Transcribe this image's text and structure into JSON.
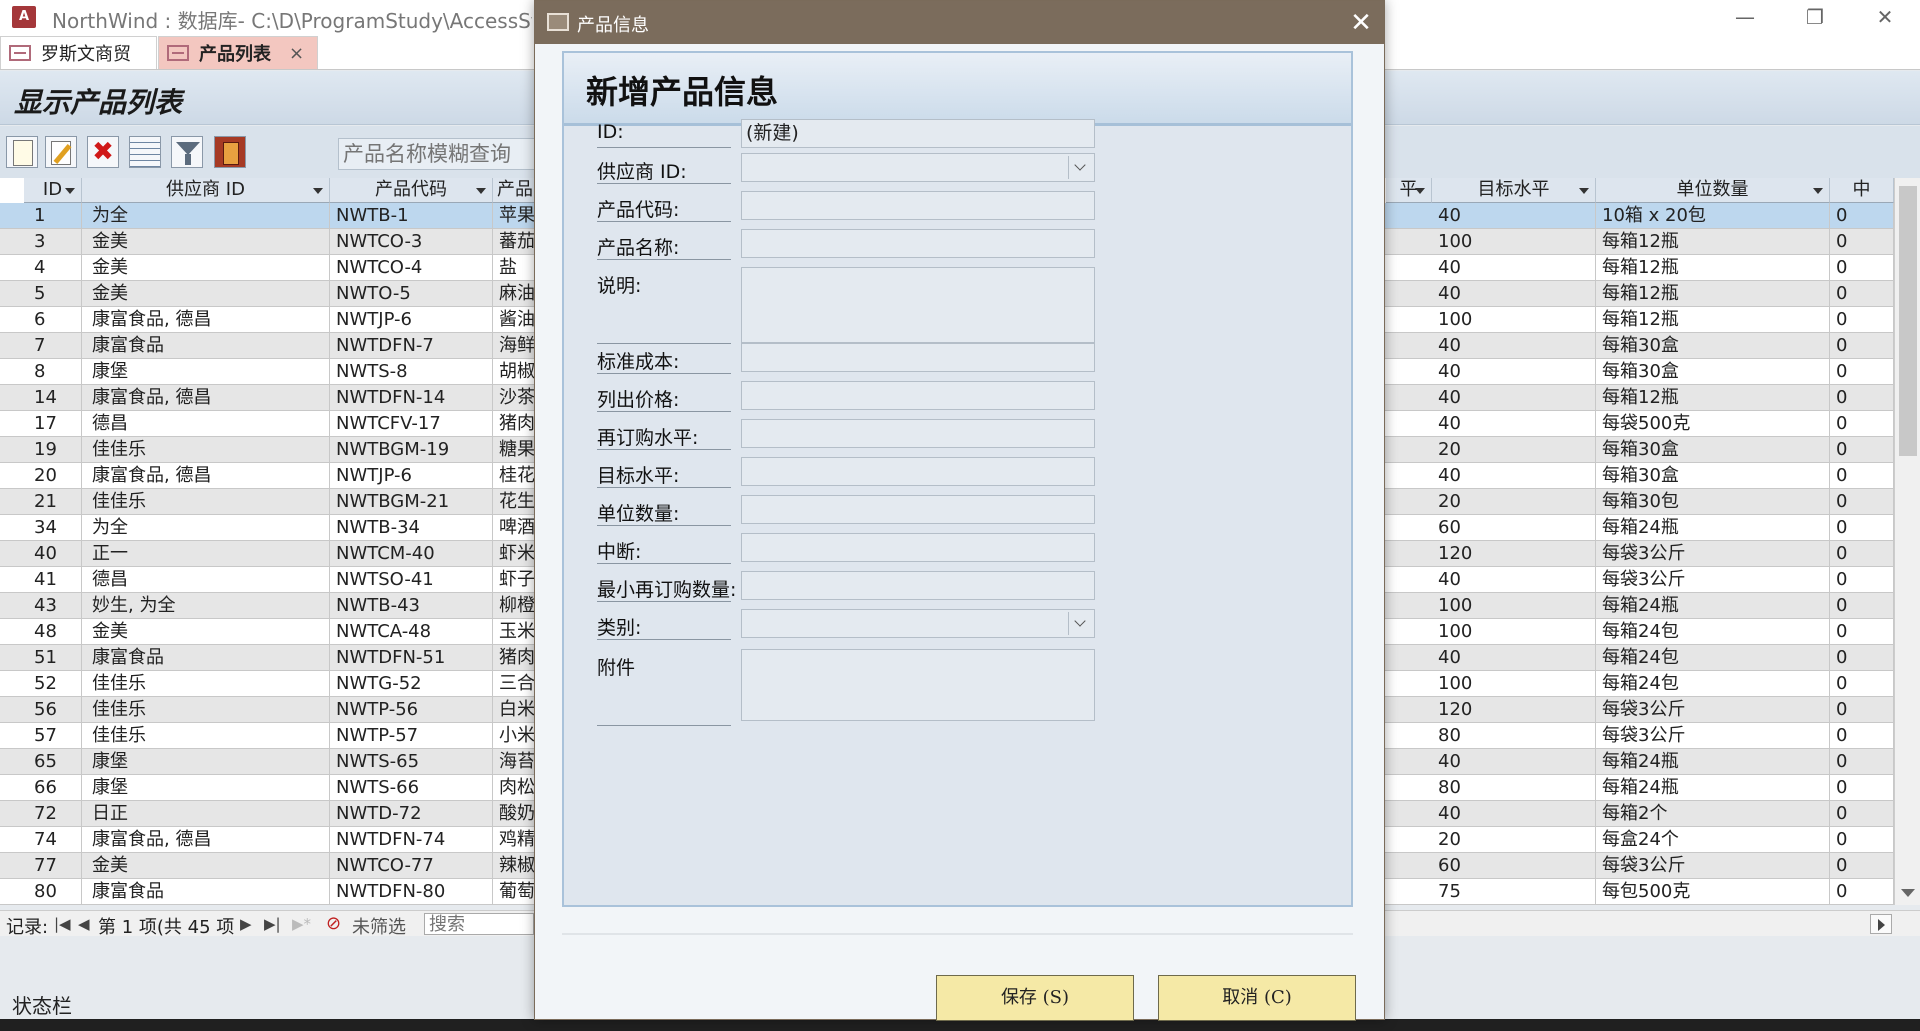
{
  "app": {
    "title": "NorthWind : 数据库- C:\\D\\ProgramStudy\\AccessStudy\\w",
    "icon": "access-icon",
    "window_controls": [
      "—",
      "❐",
      "✕"
    ]
  },
  "doc_tabs": [
    {
      "label": "罗斯文商贸",
      "active": false
    },
    {
      "label": "产品列表",
      "active": true
    }
  ],
  "doc_tab_close": "×",
  "form": {
    "title": "显示产品列表",
    "search_placeholder": "产品名称模糊查询",
    "toolbar_icons": [
      "new-record-icon",
      "edit-record-icon",
      "delete-icon",
      "datasheet-icon",
      "filter-icon",
      "exit-icon"
    ],
    "delete_glyph": "✖"
  },
  "grid": {
    "headers": [
      "ID",
      "供应商 ID",
      "产品代码",
      "产品",
      "平",
      "目标水平",
      "单位数量",
      "中"
    ],
    "rows": [
      {
        "id": "1",
        "supplier": "为全",
        "code": "NWTB-1",
        "name": "苹果",
        "target": "40",
        "qty": "10箱 x 20包",
        "disc": "0"
      },
      {
        "id": "3",
        "supplier": "金美",
        "code": "NWTCO-3",
        "name": "蕃茄",
        "target": "100",
        "qty": "每箱12瓶",
        "disc": "0"
      },
      {
        "id": "4",
        "supplier": "金美",
        "code": "NWTCO-4",
        "name": "盐",
        "target": "40",
        "qty": "每箱12瓶",
        "disc": "0"
      },
      {
        "id": "5",
        "supplier": "金美",
        "code": "NWTO-5",
        "name": "麻油",
        "target": "40",
        "qty": "每箱12瓶",
        "disc": "0"
      },
      {
        "id": "6",
        "supplier": "康富食品, 德昌",
        "code": "NWTJP-6",
        "name": "酱油",
        "target": "100",
        "qty": "每箱12瓶",
        "disc": "0"
      },
      {
        "id": "7",
        "supplier": "康富食品",
        "code": "NWTDFN-7",
        "name": "海鲜",
        "target": "40",
        "qty": "每箱30盒",
        "disc": "0"
      },
      {
        "id": "8",
        "supplier": "康堡",
        "code": "NWTS-8",
        "name": "胡椒",
        "target": "40",
        "qty": "每箱30盒",
        "disc": "0"
      },
      {
        "id": "14",
        "supplier": "康富食品, 德昌",
        "code": "NWTDFN-14",
        "name": "沙茶",
        "target": "40",
        "qty": "每箱12瓶",
        "disc": "0"
      },
      {
        "id": "17",
        "supplier": "德昌",
        "code": "NWTCFV-17",
        "name": "猪肉",
        "target": "40",
        "qty": "每袋500克",
        "disc": "0"
      },
      {
        "id": "19",
        "supplier": "佳佳乐",
        "code": "NWTBGM-19",
        "name": "糖果",
        "target": "20",
        "qty": "每箱30盒",
        "disc": "0"
      },
      {
        "id": "20",
        "supplier": "康富食品, 德昌",
        "code": "NWTJP-6",
        "name": "桂花",
        "target": "40",
        "qty": "每箱30盒",
        "disc": "0"
      },
      {
        "id": "21",
        "supplier": "佳佳乐",
        "code": "NWTBGM-21",
        "name": "花生",
        "target": "20",
        "qty": "每箱30包",
        "disc": "0"
      },
      {
        "id": "34",
        "supplier": "为全",
        "code": "NWTB-34",
        "name": "啤酒",
        "target": "60",
        "qty": "每箱24瓶",
        "disc": "0"
      },
      {
        "id": "40",
        "supplier": "正一",
        "code": "NWTCM-40",
        "name": "虾米",
        "target": "120",
        "qty": "每袋3公斤",
        "disc": "0"
      },
      {
        "id": "41",
        "supplier": "德昌",
        "code": "NWTSO-41",
        "name": "虾子",
        "target": "40",
        "qty": "每袋3公斤",
        "disc": "0"
      },
      {
        "id": "43",
        "supplier": "妙生, 为全",
        "code": "NWTB-43",
        "name": "柳橙",
        "target": "100",
        "qty": "每箱24瓶",
        "disc": "0"
      },
      {
        "id": "48",
        "supplier": "金美",
        "code": "NWTCA-48",
        "name": "玉米",
        "target": "100",
        "qty": "每箱24包",
        "disc": "0"
      },
      {
        "id": "51",
        "supplier": "康富食品",
        "code": "NWTDFN-51",
        "name": "猪肉",
        "target": "40",
        "qty": "每箱24包",
        "disc": "0"
      },
      {
        "id": "52",
        "supplier": "佳佳乐",
        "code": "NWTG-52",
        "name": "三合",
        "target": "100",
        "qty": "每箱24包",
        "disc": "0"
      },
      {
        "id": "56",
        "supplier": "佳佳乐",
        "code": "NWTP-56",
        "name": "白米",
        "target": "120",
        "qty": "每袋3公斤",
        "disc": "0"
      },
      {
        "id": "57",
        "supplier": "佳佳乐",
        "code": "NWTP-57",
        "name": "小米",
        "target": "80",
        "qty": "每袋3公斤",
        "disc": "0"
      },
      {
        "id": "65",
        "supplier": "康堡",
        "code": "NWTS-65",
        "name": "海苔",
        "target": "40",
        "qty": "每箱24瓶",
        "disc": "0"
      },
      {
        "id": "66",
        "supplier": "康堡",
        "code": "NWTS-66",
        "name": "肉松",
        "target": "80",
        "qty": "每箱24瓶",
        "disc": "0"
      },
      {
        "id": "72",
        "supplier": "日正",
        "code": "NWTD-72",
        "name": "酸奶",
        "target": "40",
        "qty": "每箱2个",
        "disc": "0"
      },
      {
        "id": "74",
        "supplier": "康富食品, 德昌",
        "code": "NWTDFN-74",
        "name": "鸡精",
        "target": "20",
        "qty": "每盒24个",
        "disc": "0"
      },
      {
        "id": "77",
        "supplier": "金美",
        "code": "NWTCO-77",
        "name": "辣椒",
        "target": "60",
        "qty": "每袋3公斤",
        "disc": "0"
      },
      {
        "id": "80",
        "supplier": "康富食品",
        "code": "NWTDFN-80",
        "name": "葡萄",
        "target": "75",
        "qty": "每包500克",
        "disc": "0"
      }
    ]
  },
  "record_nav": {
    "label": "记录:",
    "first": "|◀",
    "prev": "◀",
    "position": "第 1 项(共 45 项",
    "next": "▶",
    "last": "▶|",
    "new": "▶*",
    "filter": "未筛选",
    "search": "搜索"
  },
  "status": "状态栏",
  "dialog": {
    "title": "产品信息",
    "close": "✕",
    "heading": "新增产品信息",
    "fields": [
      {
        "label": "ID:",
        "value": "(新建)",
        "type": "text"
      },
      {
        "label": "供应商 ID:",
        "value": "",
        "type": "combo"
      },
      {
        "label": "产品代码:",
        "value": "",
        "type": "text"
      },
      {
        "label": "产品名称:",
        "value": "",
        "type": "text"
      },
      {
        "label": "说明:",
        "value": "",
        "type": "memo"
      },
      {
        "label": "标准成本:",
        "value": "",
        "type": "text"
      },
      {
        "label": "列出价格:",
        "value": "",
        "type": "text"
      },
      {
        "label": "再订购水平:",
        "value": "",
        "type": "text"
      },
      {
        "label": "目标水平:",
        "value": "",
        "type": "text"
      },
      {
        "label": "单位数量:",
        "value": "",
        "type": "text"
      },
      {
        "label": "中断:",
        "value": "",
        "type": "text"
      },
      {
        "label": "最小再订购数量:",
        "value": "",
        "type": "text"
      },
      {
        "label": "类别:",
        "value": "",
        "type": "combo"
      },
      {
        "label": "附件",
        "value": "",
        "type": "memo"
      }
    ],
    "save_label": "保存 (S)",
    "cancel_label": "取消 (C)"
  },
  "colors": {
    "selected_row": "#bdd7ee",
    "active_tab": "#f3c7c0",
    "dialog_titlebar": "#7b6c5c",
    "button_fill": "#f5e9a6"
  }
}
